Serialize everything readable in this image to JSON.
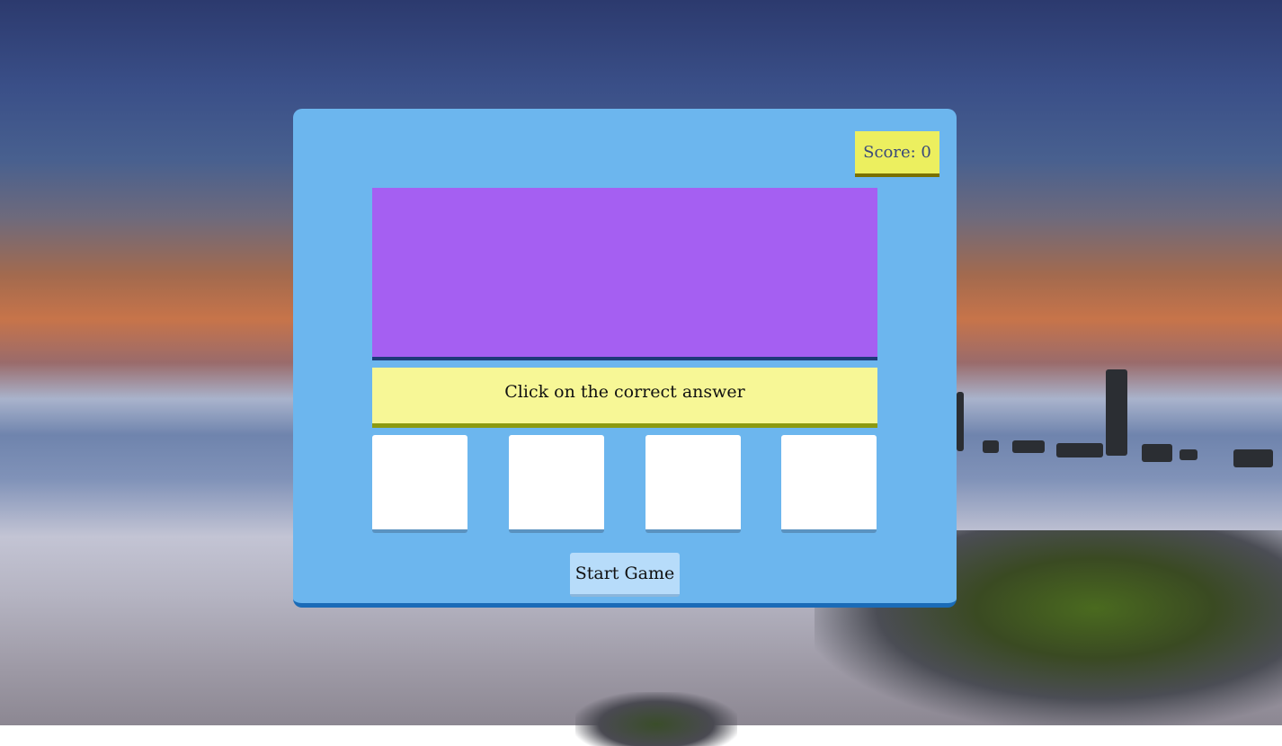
{
  "game": {
    "score_label": "Score: 0",
    "prompt": "Click on the correct answer",
    "start_label": "Start Game",
    "choices": [
      "",
      "",
      "",
      ""
    ]
  },
  "colors": {
    "panel": "#6cb6ee",
    "panel_border": "#1a6bb7",
    "score_bg": "#ecef5f",
    "display_bg": "#a55ff2",
    "prompt_bg": "#f7f796",
    "choice_bg": "#ffffff",
    "start_bg": "#b7dcfa"
  }
}
